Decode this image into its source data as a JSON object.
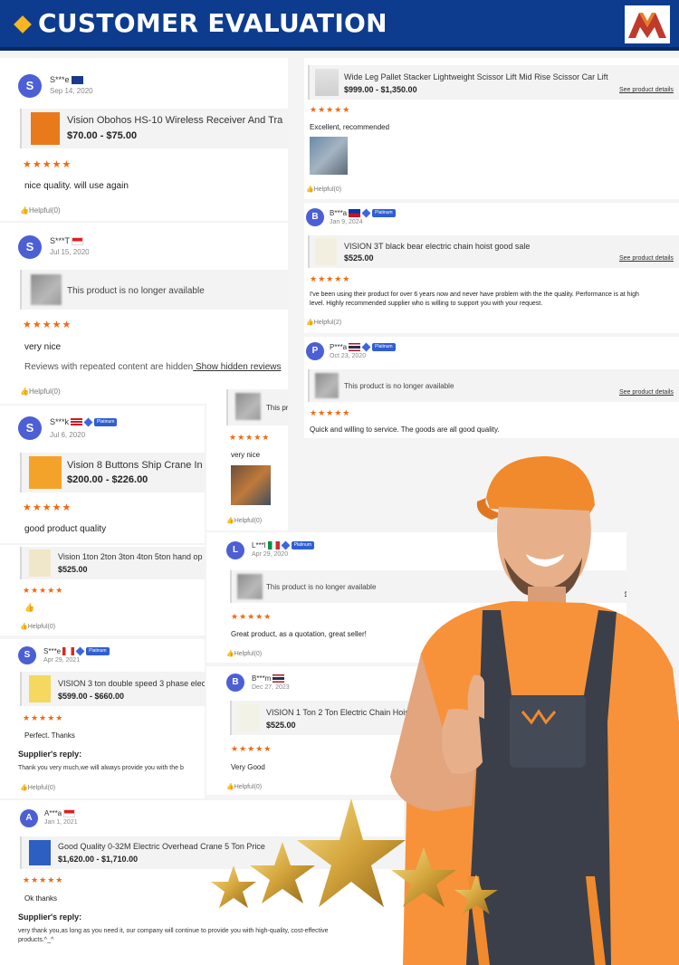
{
  "banner": {
    "title": "CUSTOMER EVALUATION",
    "logo_icon": "brand-m-logo"
  },
  "colors": {
    "banner": "#0d3c8e",
    "accent": "#f5b622",
    "stars": "#ee6a12",
    "avatar": "#4c5fd5"
  },
  "common": {
    "stars": "★★★★★",
    "helpful": "Helpful(0)",
    "helpful2": "Helpful(2)",
    "see_details": "See product details",
    "unavailable": "This product is no longer available",
    "platinum": "Platinum",
    "supplier_reply": "Supplier's reply:"
  },
  "left": [
    {
      "initial": "S",
      "name": "S***e",
      "date": "Sep 14, 2020",
      "product": "Vision Obohos HS-10 Wireless Receiver And Tra",
      "price": "$70.00 - $75.00",
      "text": "nice quality. will use again"
    },
    {
      "initial": "S",
      "name": "S***T",
      "date": "Jul 15, 2020",
      "text": "very nice",
      "hidden_note": "Reviews with repeated content are hidden",
      "hidden_link": " Show hidden reviews"
    },
    {
      "initial": "S",
      "name": "S***k",
      "date": "Jul 6, 2020",
      "product": "Vision 8 Buttons Ship Crane In",
      "price": "$200.00 - $226.00",
      "text": "good product quality"
    },
    {
      "product": "Vision 1ton 2ton 3ton 4ton 5ton hand op",
      "price": "$525.00",
      "text": "👍"
    },
    {
      "initial": "S",
      "name": "S***e",
      "date": "Apr 29, 2021",
      "product": "VISION 3 ton double speed 3 phase elec",
      "price": "$599.00 - $660.00",
      "text": "Perfect. Thanks",
      "reply": "Thank you very much,we will always provide you with the b"
    },
    {
      "initial": "A",
      "name": "A***a",
      "date": "Jan 1, 2021",
      "product": "Good Quality 0-32M Electric Overhead Crane 5 Ton Price",
      "price": "$1,620.00 - $1,710.00",
      "text": "Ok thanks",
      "reply1": "very thank you,as long as you need it, our company will continue to provide you with high-quality, cost-effective",
      "reply2": "products.^_^"
    }
  ],
  "middle": [
    {
      "product": "This pr",
      "text": "very nice"
    },
    {
      "initial": "L",
      "name": "L***l",
      "date": "Apr 29, 2020",
      "text": "Great product, as a quotation, great seller!",
      "partial_link": "etails"
    },
    {
      "initial": "B",
      "name": "B***m",
      "date": "Dec 27, 2023",
      "product": "VISION 1 Ton 2 Ton Electric Chain Hoist 2",
      "price": "$525.00",
      "text": "Very Good"
    }
  ],
  "right": [
    {
      "product": "Wide Leg Pallet Stacker Lightweight Scissor Lift Mid Rise Scissor Car Lift",
      "price": "$999.00 - $1,350.00",
      "text": "Excellent, recommended"
    },
    {
      "initial": "B",
      "name": "B***a",
      "date": "Jan 9, 2024",
      "product": "VISION 3T black bear electric chain hoist good sale",
      "price": "$525.00",
      "text1": "I've been using their product for over 6 years now and never have problem with the the quality. Performance is at high",
      "text2": "level. Highly recommended supplier who is willing to support you with your request."
    },
    {
      "initial": "P",
      "name": "P***a",
      "date": "Oct 23, 2020",
      "text": "Quick and willing to service. The goods are all good quality."
    }
  ]
}
